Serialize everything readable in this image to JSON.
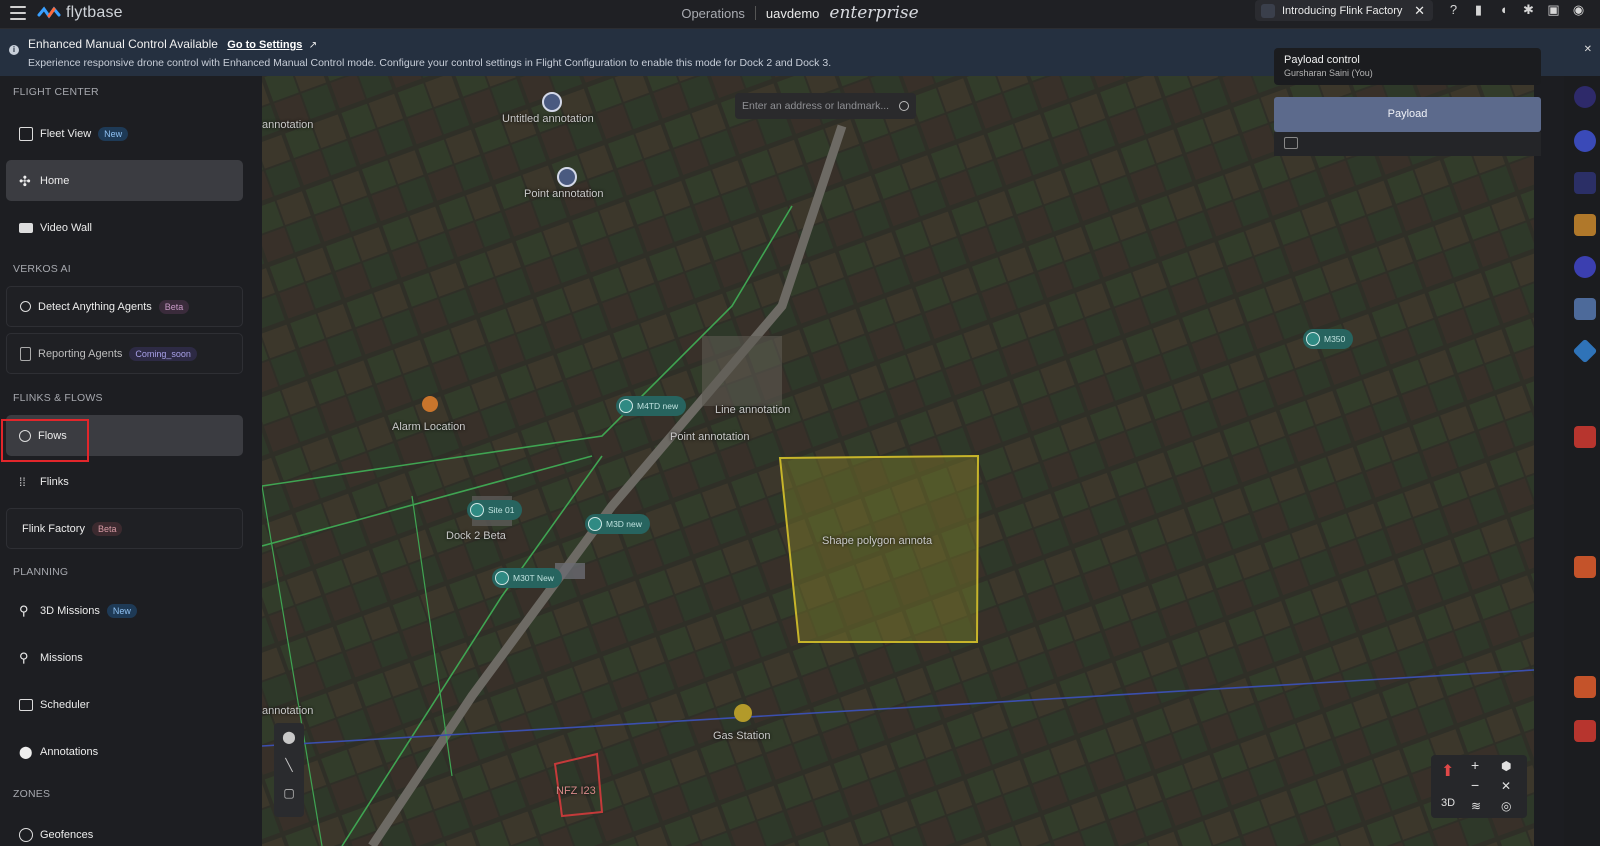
{
  "topbar": {
    "logo_text": "flytbase",
    "section": "Operations",
    "org": "uavdemo",
    "edition": "enterprise",
    "promo_label": "Introducing Flink Factory",
    "promo_close": "✕",
    "icons": [
      "help-icon",
      "analytics-icon",
      "bell-icon",
      "gear-icon",
      "gift-icon",
      "user-icon"
    ]
  },
  "banner": {
    "title": "Enhanced Manual Control Available",
    "link": "Go to Settings",
    "description": "Experience responsive drone control with Enhanced Manual Control mode. Configure your control settings in Flight Configuration to enable this mode for Dock 2 and Dock 3.",
    "close": "✕"
  },
  "sidebar": {
    "sections": {
      "flight_center": "FLIGHT CENTER",
      "verkos_ai": "VERKOS AI",
      "flinks_flows": "FLINKS & FLOWS",
      "planning": "PLANNING",
      "zones": "ZONES"
    },
    "items": {
      "fleet_view": {
        "label": "Fleet View",
        "badge": "New"
      },
      "home": {
        "label": "Home"
      },
      "video_wall": {
        "label": "Video Wall"
      },
      "detect_agents": {
        "label": "Detect Anything Agents",
        "badge": "Beta"
      },
      "reporting_agents": {
        "label": "Reporting Agents",
        "badge": "Coming_soon"
      },
      "flows": {
        "label": "Flows"
      },
      "flinks": {
        "label": "Flinks"
      },
      "flink_factory": {
        "label": "Flink Factory",
        "badge": "Beta"
      },
      "missions_3d": {
        "label": "3D Missions",
        "badge": "New"
      },
      "missions": {
        "label": "Missions"
      },
      "scheduler": {
        "label": "Scheduler"
      },
      "annotations": {
        "label": "Annotations"
      },
      "geofences": {
        "label": "Geofences"
      }
    }
  },
  "map": {
    "search_placeholder": "Enter an address or landmark...",
    "labels": {
      "untitled_annotation": "Untitled annotation",
      "point_annotation_top": "Point annotation",
      "annotation_left_top": "annotation",
      "alarm_location": "Alarm Location",
      "line_annotation": "Line annotation",
      "point_annotation_mid": "Point annotation",
      "dock2": "Dock 2 Beta",
      "polygon": "Shape polygon annota",
      "gas_station": "Gas Station",
      "nfz": "NFZ I23",
      "annotation_left_bottom": "annotation"
    },
    "pins": {
      "m4td": "M4TD new",
      "site01": "Site 01",
      "m3d": "M3D new",
      "m30t": "M30T New",
      "m350": "M350"
    },
    "controls": {
      "zoom_in": "+",
      "zoom_out": "−",
      "mode": "3D"
    }
  },
  "payload": {
    "title": "Payload control",
    "user": "Gursharan Saini (You)",
    "tab": "Payload"
  }
}
